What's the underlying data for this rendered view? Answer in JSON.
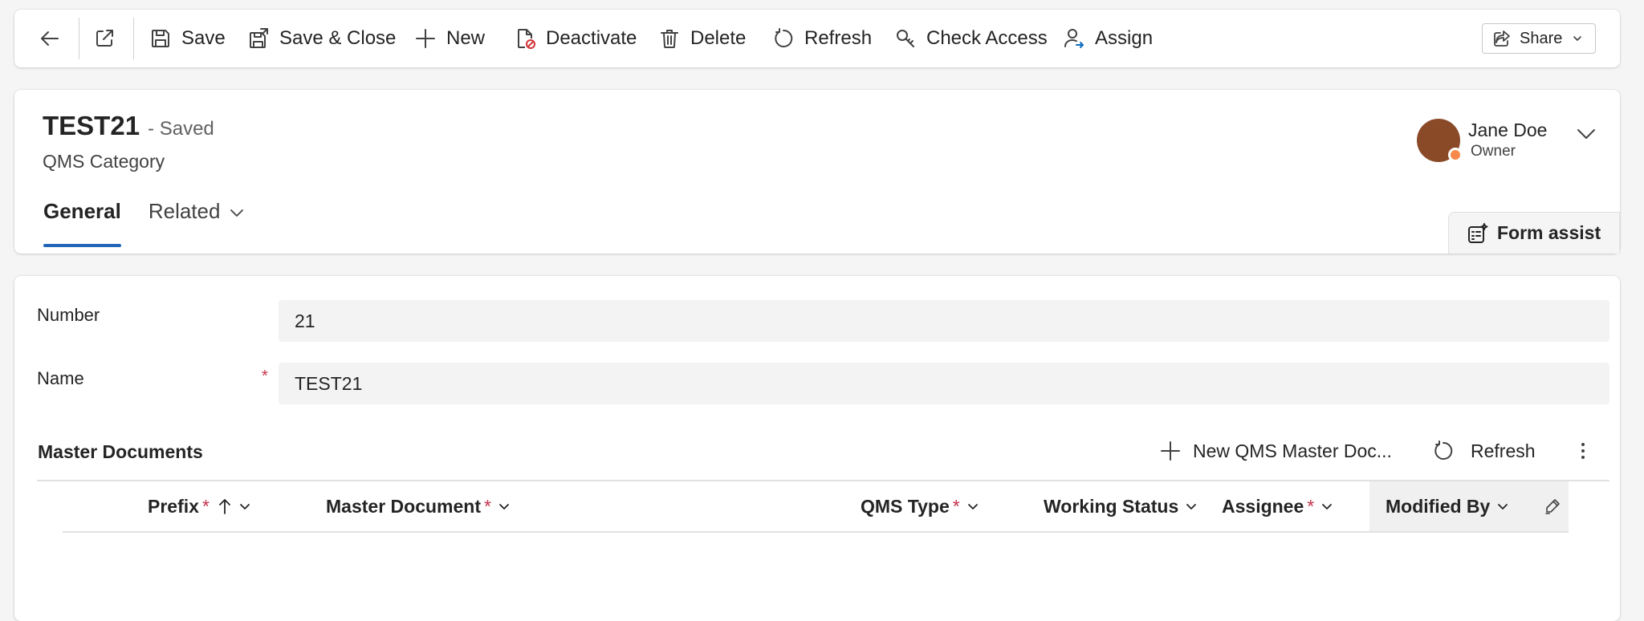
{
  "commandbar": {
    "save": "Save",
    "save_close": "Save & Close",
    "new": "New",
    "deactivate": "Deactivate",
    "delete": "Delete",
    "refresh": "Refresh",
    "check_access": "Check Access",
    "assign": "Assign",
    "share": "Share"
  },
  "record": {
    "title": "TEST21",
    "status": "- Saved",
    "entity": "QMS Category"
  },
  "owner": {
    "name": "Jane Doe",
    "role": "Owner",
    "avatar_color": "#8b4a27",
    "presence_color": "#f7894a"
  },
  "tabs": [
    {
      "label": "General"
    },
    {
      "label": "Related"
    }
  ],
  "form_assist": "Form assist",
  "fields": {
    "number": {
      "label": "Number",
      "value": "21"
    },
    "name": {
      "label": "Name",
      "value": "TEST21",
      "required": "*"
    }
  },
  "subgrid": {
    "title": "Master Documents",
    "new_label": "New QMS Master Doc...",
    "refresh_label": "Refresh",
    "columns": [
      {
        "label": "Prefix",
        "required": "*"
      },
      {
        "label": "Master Document",
        "required": "*"
      },
      {
        "label": "QMS Type",
        "required": "*"
      },
      {
        "label": "Working Status",
        "required": ""
      },
      {
        "label": "Assignee",
        "required": "*"
      },
      {
        "label": "Modified By",
        "required": ""
      }
    ]
  },
  "colors": {
    "accent": "#2166b7",
    "required": "#c4314b",
    "page_bg": "#f5f5f5"
  }
}
